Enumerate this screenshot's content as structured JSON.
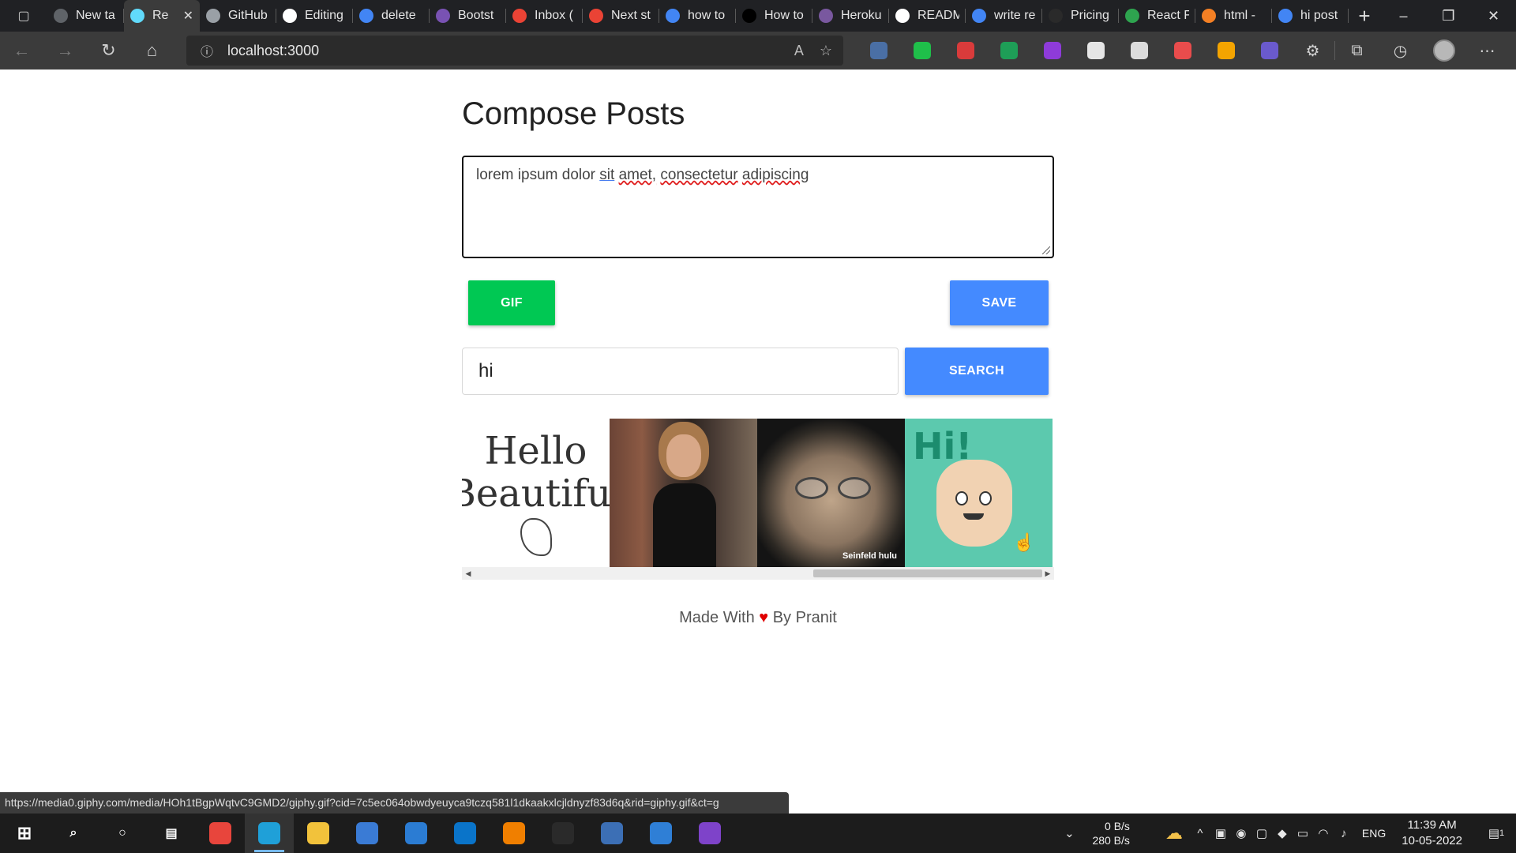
{
  "browser": {
    "tabs": [
      {
        "label": "New ta",
        "icon": "new-tab-page-icon",
        "color": "#5f6368",
        "active": false
      },
      {
        "label": "Re",
        "icon": "react-icon",
        "color": "#61dafb",
        "active": true
      },
      {
        "label": "GitHub",
        "icon": "document-icon",
        "color": "#9aa0a6",
        "active": false
      },
      {
        "label": "Editing",
        "icon": "github-icon",
        "color": "#ffffff",
        "active": false
      },
      {
        "label": "delete",
        "icon": "google-icon",
        "color": "#4285f4",
        "active": false
      },
      {
        "label": "Bootst",
        "icon": "bootstrap-icon",
        "color": "#7952b3",
        "active": false
      },
      {
        "label": "Inbox (",
        "icon": "gmail-icon",
        "color": "#ea4335",
        "active": false
      },
      {
        "label": "Next st",
        "icon": "gmail-icon",
        "color": "#ea4335",
        "active": false
      },
      {
        "label": "how to",
        "icon": "google-icon",
        "color": "#4285f4",
        "active": false
      },
      {
        "label": "How to",
        "icon": "medium-icon",
        "color": "#000000",
        "active": false
      },
      {
        "label": "Heroku",
        "icon": "heroku-icon",
        "color": "#79589f",
        "active": false
      },
      {
        "label": "READM",
        "icon": "readme-icon",
        "color": "#ffffff",
        "active": false
      },
      {
        "label": "write re",
        "icon": "google-icon",
        "color": "#4285f4",
        "active": false
      },
      {
        "label": "Pricing",
        "icon": "blank-page-icon",
        "color": "#2a2a2a",
        "active": false
      },
      {
        "label": "React F",
        "icon": "react-router-icon",
        "color": "#2ea44f",
        "active": false
      },
      {
        "label": "html -",
        "icon": "stackoverflow-icon",
        "color": "#f48024",
        "active": false
      },
      {
        "label": "hi post",
        "icon": "google-icon",
        "color": "#4285f4",
        "active": false
      }
    ],
    "address": "localhost:3000",
    "extensions": [
      {
        "name": "bookmark-star-extension-icon",
        "color": "#4a6fa5"
      },
      {
        "name": "shield-extension-icon",
        "color": "#1fbf4a"
      },
      {
        "name": "puzzle-red-extension-icon",
        "color": "#d93b3b"
      },
      {
        "name": "flag-extension-icon",
        "color": "#1e9e57"
      },
      {
        "name": "purple-circle-extension-icon",
        "color": "#8e3bd9"
      },
      {
        "name": "clock-extension-icon",
        "color": "#e6e6e6"
      },
      {
        "name": "rs-extension-icon",
        "color": "#dcdcdc"
      },
      {
        "name": "color-wheel-extension-icon",
        "color": "#e94c4c"
      },
      {
        "name": "orange-circle-extension-icon",
        "color": "#f4a400"
      },
      {
        "name": "ring-extension-icon",
        "color": "#6a5acd"
      }
    ],
    "status_url": "https://media0.giphy.com/media/HOh1tBgpWqtvC9GMD2/giphy.gif?cid=7c5ec064obwdyeuyca9tczq581l1dkaakxlcjldnyzf83d6q&rid=giphy.gif&ct=g"
  },
  "page": {
    "title": "Compose Posts",
    "post_text": {
      "w1": "lorem ipsum dolor ",
      "w2": "sit",
      "w3": " ",
      "w4": "amet,",
      "w5": " ",
      "w6": "consectetur",
      "w7": " ",
      "w8": "adipiscing"
    },
    "gif_button": "GIF",
    "save_button": "SAVE",
    "search_value": "hi",
    "search_button": "SEARCH",
    "gifs": {
      "hello_line1": "Hello",
      "hello_line2": "Beautiful",
      "man_tag": "Seinfeld hulu",
      "hand_text": "Hi!"
    },
    "footer": {
      "prefix": "Made With ",
      "heart": "♥",
      "suffix": " By Pranit"
    },
    "colors": {
      "gif": "#00c853",
      "save": "#448aff",
      "search": "#448aff",
      "heart": "#e00000"
    }
  },
  "taskbar": {
    "apps": [
      {
        "name": "chrome-taskbar-icon",
        "color": "#e8453c",
        "glyph": "",
        "active": false
      },
      {
        "name": "edge-taskbar-icon",
        "color": "#1fa0d8",
        "glyph": "",
        "active": true
      },
      {
        "name": "file-explorer-taskbar-icon",
        "color": "#f2c23b",
        "glyph": "",
        "active": false
      },
      {
        "name": "store-taskbar-icon",
        "color": "#3a7bd5",
        "glyph": "",
        "active": false
      },
      {
        "name": "mail-taskbar-icon",
        "color": "#2b7cd3",
        "glyph": "",
        "active": false
      },
      {
        "name": "vscode-taskbar-icon",
        "color": "#0a74c9",
        "glyph": "",
        "active": false
      },
      {
        "name": "search-app-taskbar-icon",
        "color": "#f07f00",
        "glyph": "",
        "active": false
      },
      {
        "name": "terminal-taskbar-icon",
        "color": "#2a2a2a",
        "glyph": "",
        "active": false
      },
      {
        "name": "powershell-taskbar-icon",
        "color": "#3c6fb5",
        "glyph": "",
        "active": false
      },
      {
        "name": "firefox-taskbar-icon",
        "color": "#2f7fd6",
        "glyph": "",
        "active": false
      },
      {
        "name": "github-desktop-taskbar-icon",
        "color": "#7e43c9",
        "glyph": "",
        "active": false
      }
    ],
    "net_up": "0 B/s",
    "net_down": "280 B/s",
    "language": "ENG",
    "time": "11:39 AM",
    "date": "10-05-2022",
    "notifications": "1"
  }
}
